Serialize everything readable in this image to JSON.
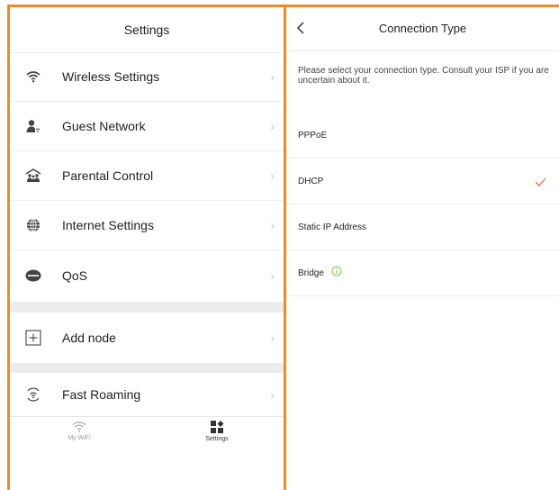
{
  "settings_panel": {
    "title": "Settings",
    "items": [
      {
        "label": "Wireless Settings",
        "icon": "wifi-icon"
      },
      {
        "label": "Guest Network",
        "icon": "guest-user-icon"
      },
      {
        "label": "Parental Control",
        "icon": "family-icon"
      },
      {
        "label": "Internet Settings",
        "icon": "globe-icon"
      },
      {
        "label": "QoS",
        "icon": "qos-speed-icon"
      },
      {
        "label": "Add node",
        "icon": "add-box-icon"
      },
      {
        "label": "Fast Roaming",
        "icon": "roaming-icon"
      }
    ],
    "chevron": "›"
  },
  "tabbar": {
    "tabs": [
      {
        "label": "My WiFi",
        "icon": "wifi-icon",
        "active": false
      },
      {
        "label": "Settings",
        "icon": "grid-icon",
        "active": true
      }
    ]
  },
  "connection_panel": {
    "title": "Connection Type",
    "description": "Please select your connection type. Consult your ISP if you are uncertain about it.",
    "options": [
      {
        "label": "PPPoE",
        "selected": false
      },
      {
        "label": "DHCP",
        "selected": true
      },
      {
        "label": "Static IP Address",
        "selected": false
      },
      {
        "label": "Bridge",
        "selected": false,
        "has_info": true
      }
    ]
  },
  "colors": {
    "accent": "#f08a24",
    "check": "#e8704a",
    "info": "#7dc242"
  }
}
